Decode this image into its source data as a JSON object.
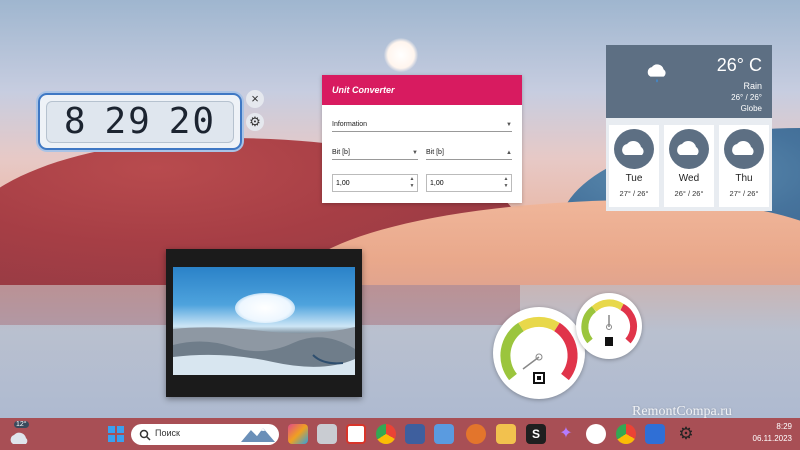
{
  "widgets": {
    "clock": {
      "hours": "8",
      "minutes": "29",
      "seconds": "20",
      "close": "×",
      "settings": "⚙"
    },
    "unit_converter": {
      "title": "Unit Converter",
      "category": "Information",
      "from_unit": "Bit [b]",
      "to_unit": "Bit [b]",
      "from_value": "1,00",
      "to_value": "1,00"
    },
    "weather": {
      "temperature": "26° C",
      "condition": "Rain",
      "range": "26° / 26°",
      "location": "Globe",
      "forecast": [
        {
          "day": "Tue",
          "range": "27° / 26°"
        },
        {
          "day": "Wed",
          "range": "26° / 26°"
        },
        {
          "day": "Thu",
          "range": "27° / 26°"
        }
      ]
    }
  },
  "watermark": "RemontCompa.ru",
  "taskbar": {
    "weather_badge": "12°",
    "search_placeholder": "Поиск",
    "time": "8:29",
    "date": "06.11.2023",
    "icons": [
      "start-icon",
      "search-icon",
      "app-icon",
      "window-icon",
      "power-icon",
      "chrome-icon",
      "save-icon",
      "pencil-icon",
      "browser-icon",
      "folder-icon",
      "s-icon",
      "sparkle-icon",
      "chatgpt-icon",
      "chrome-profile-icon",
      "app-grid-icon",
      "gear-icon"
    ]
  },
  "colors": {
    "taskbar": "#a84f55",
    "converter_accent": "#d81b60",
    "weather_panel": "#5d6f83"
  }
}
